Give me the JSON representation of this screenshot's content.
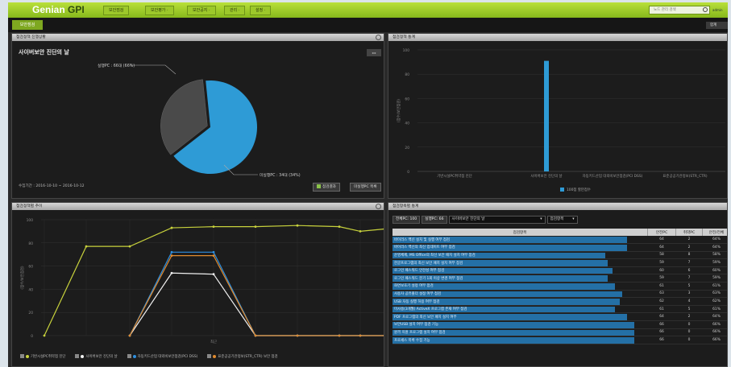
{
  "app": {
    "logo_main": "Genian",
    "logo_accent": "GPI",
    "search_placeholder": "노드 관리 검색",
    "user": "admin"
  },
  "menu": [
    "보안점검",
    "보안평가 ·",
    "보안공지 ·",
    "관리 ·",
    "설정 ·"
  ],
  "subbar": {
    "tab": "보안점검",
    "right": "합계"
  },
  "panels": {
    "status": {
      "title": "점검정책 진행상황",
      "subtitle": "사이버보안 진단의 날",
      "period": "수집기간 : 2016-10-10 ~ 2016-10-12",
      "btn_result": "점검결과",
      "btn_missing": "미실행PC 목록",
      "nav": "◂ ▸"
    },
    "stats": {
      "title": "점검정책 통계"
    },
    "trend": {
      "title": "점검정책별 추이"
    },
    "items": {
      "title": "점검항목별 통계",
      "badge_all": "전체PC: 100",
      "badge_run": "실행PC: 66",
      "select_policy": "사이버보안 진단의 날",
      "select_item": "점검항목"
    }
  },
  "table": {
    "headers": [
      "점검항목",
      "안전PC",
      "취약PC",
      "안전/전체"
    ],
    "rows": [
      {
        "name": "바이러스 백신 설치 및 실행 여부 점검",
        "safe": "64",
        "vuln": "2",
        "ratio": "64%",
        "pct": 0.97
      },
      {
        "name": "바이러스 백신의 최신 업데이트 여부 점검",
        "safe": "64",
        "vuln": "2",
        "ratio": "64%",
        "pct": 0.97
      },
      {
        "name": "운영체제, MS Office의 최신 보안 패치 설치 여부 점검",
        "safe": "58",
        "vuln": "8",
        "ratio": "58%",
        "pct": 0.88
      },
      {
        "name": "한글프로그램의 최신 보안 패치 설치 여부 점검",
        "safe": "59",
        "vuln": "7",
        "ratio": "59%",
        "pct": 0.89
      },
      {
        "name": "로그인 패스워드 안전성 여부 점검",
        "safe": "60",
        "vuln": "6",
        "ratio": "60%",
        "pct": 0.91
      },
      {
        "name": "로그인 패스워드 분기 1회 이상 변경 여부 점검",
        "safe": "59",
        "vuln": "7",
        "ratio": "59%",
        "pct": 0.89
      },
      {
        "name": "화면보호기 설정 여부 점검",
        "safe": "61",
        "vuln": "5",
        "ratio": "61%",
        "pct": 0.92
      },
      {
        "name": "사용자 공유폴더 설정 여부 점검",
        "safe": "63",
        "vuln": "3",
        "ratio": "63%",
        "pct": 0.95
      },
      {
        "name": "USB 자동 실행 허용 여부 점검",
        "safe": "62",
        "vuln": "4",
        "ratio": "62%",
        "pct": 0.94
      },
      {
        "name": "미사용(3개월) ActiveX 프로그램 존재 여부 점검",
        "safe": "61",
        "vuln": "5",
        "ratio": "61%",
        "pct": 0.92
      },
      {
        "name": "PDF 프로그램의 최신 보안 패치 설치 여부",
        "safe": "64",
        "vuln": "2",
        "ratio": "64%",
        "pct": 0.97
      },
      {
        "name": "보안USB 설치 여부 점검 기능",
        "safe": "66",
        "vuln": "0",
        "ratio": "66%",
        "pct": 1.0
      },
      {
        "name": "원격 지원 프로그램 설치 여부 점검",
        "safe": "66",
        "vuln": "0",
        "ratio": "66%",
        "pct": 1.0
      },
      {
        "name": "프로세스 목록 수집 기능",
        "safe": "66",
        "vuln": "0",
        "ratio": "66%",
        "pct": 1.0
      }
    ]
  },
  "pie": {
    "run_label": "실행PC : 66대 (66%)",
    "missing_label": "미실행PC : 34대 (34%)",
    "run_value": 66,
    "missing_value": 34,
    "run_color": "#2e9bd6",
    "missing_color": "#4a4a4a"
  },
  "chart_data": [
    {
      "type": "bar",
      "categories": [
        "기반시설PC취약점 진단",
        "사이버보안 진단의 날",
        "자동키드산업 대외비보안점검(PCI DSS)",
        "표준공공기관정보(STR_CTR)"
      ],
      "series": [
        {
          "name": "100점 할만점수",
          "values": [
            0,
            91,
            0,
            0
          ]
        }
      ],
      "ylim": [
        0,
        100
      ],
      "yticks": [
        "0",
        "20",
        "40",
        "60",
        "80",
        "100"
      ],
      "ylabel": "(점수/보안점검)"
    },
    {
      "type": "line",
      "ylim": [
        0,
        100
      ],
      "yticks": [
        "0",
        "20",
        "40",
        "60",
        "80",
        "100"
      ],
      "ylabel": "(점수/보안점검)",
      "xtick": "최근",
      "series": [
        {
          "name": "기반시설PC취약점 진단",
          "color": "#c8d23c",
          "values": [
            0,
            77,
            77,
            93,
            94,
            94,
            95,
            94,
            90,
            92
          ]
        },
        {
          "name": "사이버보안 진단의 날",
          "color": "#f0f0f0",
          "values": [
            null,
            null,
            0,
            54,
            53,
            0,
            0,
            0,
            0,
            0
          ]
        },
        {
          "name": "자동키드산업 대외비보안점검(PCI DSS)",
          "color": "#2e8fe0",
          "values": [
            null,
            null,
            0,
            72,
            72,
            0,
            0,
            0,
            0,
            0
          ]
        },
        {
          "name": "표준공공기관정보(STR_CTR) 보안 점검",
          "color": "#e08a2e",
          "values": [
            null,
            null,
            0,
            69,
            69,
            0,
            0,
            0,
            0,
            0
          ]
        }
      ]
    }
  ]
}
